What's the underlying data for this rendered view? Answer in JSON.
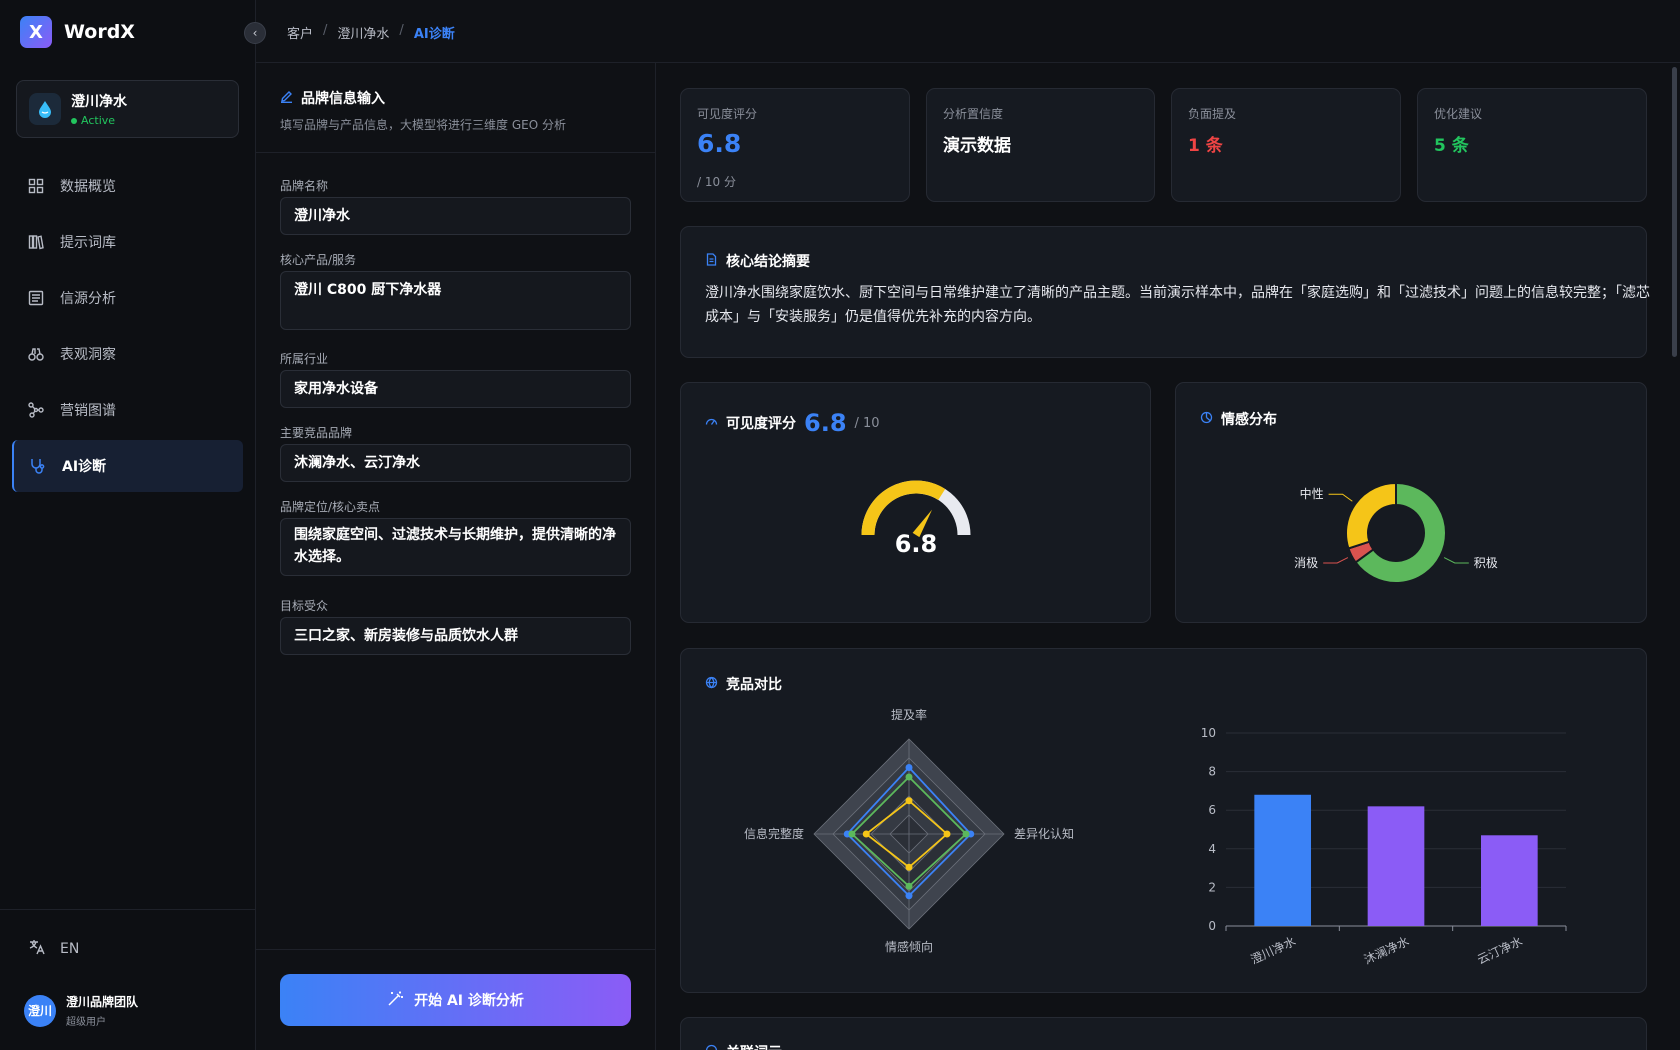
{
  "app": {
    "logo_letter": "X",
    "name": "WordX"
  },
  "client": {
    "name": "澄川净水",
    "status": "Active"
  },
  "nav": [
    {
      "label": "数据概览",
      "icon": "grid-icon"
    },
    {
      "label": "提示词库",
      "icon": "library-icon"
    },
    {
      "label": "信源分析",
      "icon": "list-icon"
    },
    {
      "label": "表观洞察",
      "icon": "binoculars-icon"
    },
    {
      "label": "营销图谱",
      "icon": "graph-icon"
    },
    {
      "label": "AI诊断",
      "icon": "stethoscope-icon",
      "active": true
    }
  ],
  "lang": {
    "label": "EN"
  },
  "user": {
    "avatar": "澄川",
    "name": "澄川品牌团队",
    "role": "超级用户"
  },
  "breadcrumb": {
    "items": [
      "客户",
      "澄川净水"
    ],
    "current": "AI诊断"
  },
  "form": {
    "title": "品牌信息输入",
    "subtitle": "填写品牌与产品信息，大模型将进行三维度 GEO 分析",
    "fields": [
      {
        "label": "品牌名称",
        "value": "澄川净水"
      },
      {
        "label": "核心产品/服务",
        "value": "澄川 C800 厨下净水器"
      },
      {
        "label": "所属行业",
        "value": "家用净水设备"
      },
      {
        "label": "主要竞品品牌",
        "value": "沐澜净水、云汀净水"
      },
      {
        "label": "品牌定位/核心卖点",
        "value": "围绕家庭空间、过滤技术与长期维护，提供清晰的净水选择。"
      },
      {
        "label": "目标受众",
        "value": "三口之家、新房装修与品质饮水人群"
      }
    ],
    "start_button": "开始 AI 诊断分析"
  },
  "stats": [
    {
      "label": "可见度评分",
      "value": "6.8",
      "sub": "/ 10 分",
      "color": "#3b82f6"
    },
    {
      "label": "分析置信度",
      "value": "演示数据",
      "color": "#ffffff"
    },
    {
      "label": "负面提及",
      "value": "1 条",
      "color": "#ef4444"
    },
    {
      "label": "优化建议",
      "value": "5 条",
      "color": "#22c55e"
    }
  ],
  "summary": {
    "title": "核心结论摘要",
    "text": "澄川净水围绕家庭饮水、厨下空间与日常维护建立了清晰的产品主题。当前演示样本中，品牌在「家庭选购」和「过滤技术」问题上的信息较完整；「滤芯成本」与「安装服务」仍是值得优先补充的内容方向。"
  },
  "visibility": {
    "title": "可见度评分",
    "score": 6.8,
    "score_text": "6.8",
    "of": "/ 10",
    "max": 10
  },
  "sentiment": {
    "title": "情感分布",
    "slices": [
      {
        "name": "积极",
        "value": 65,
        "color": "#5cb85c"
      },
      {
        "name": "消极",
        "value": 5,
        "color": "#d9534f"
      },
      {
        "name": "中性",
        "value": 30,
        "color": "#f5c518"
      }
    ]
  },
  "competitor": {
    "title": "竞品对比",
    "radar": {
      "axes": [
        "提及率",
        "差异化认知",
        "情感倾向",
        "信息完整度"
      ],
      "max": 10,
      "series": [
        {
          "values": [
            7,
            6.5,
            6.5,
            6.5
          ],
          "color": "#3b82f6"
        },
        {
          "values": [
            6,
            6,
            5.5,
            6
          ],
          "color": "#5cb85c"
        },
        {
          "values": [
            3.5,
            4,
            3.5,
            4.5
          ],
          "color": "#f5c518"
        }
      ]
    },
    "bar": {
      "categories": [
        "澄川净水",
        "沐澜净水",
        "云汀净水"
      ],
      "values": [
        6.8,
        6.2,
        4.7
      ],
      "colors": [
        "#3b82f6",
        "#8b5cf6",
        "#8b5cf6"
      ],
      "ylim": [
        0,
        10
      ],
      "yticks": [
        0,
        2,
        4,
        6,
        8,
        10
      ]
    }
  },
  "next_section": {
    "title": "关联词云"
  }
}
